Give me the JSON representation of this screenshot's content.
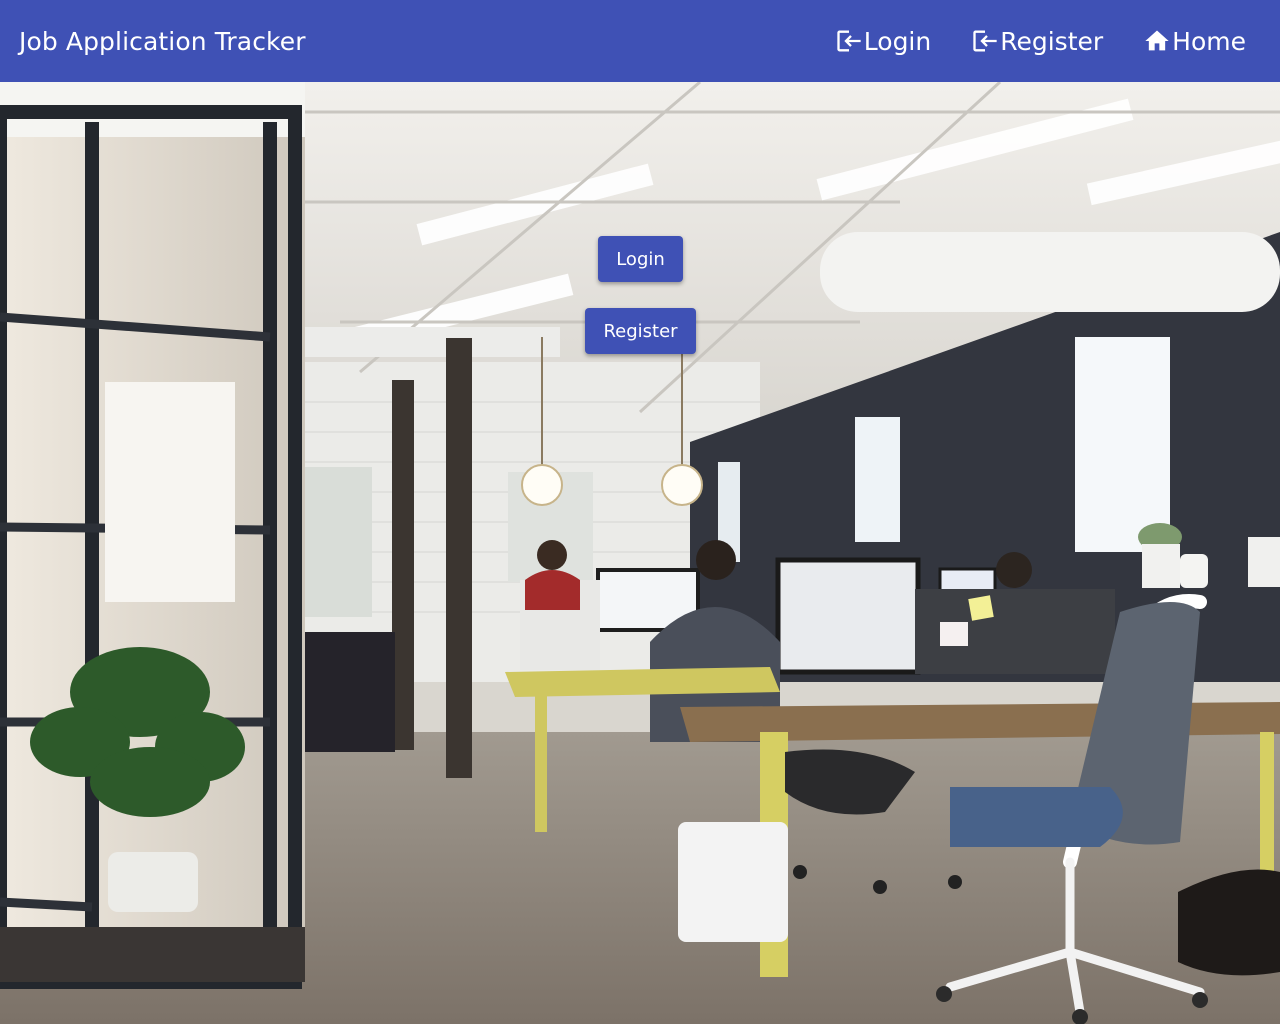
{
  "header": {
    "title": "Job Application Tracker",
    "nav": {
      "login": {
        "label": "Login",
        "icon": "login-icon"
      },
      "register": {
        "label": "Register",
        "icon": "login-icon"
      },
      "home": {
        "label": "Home",
        "icon": "home-icon"
      }
    }
  },
  "hero": {
    "image": "office-interior-photo",
    "buttons": {
      "login": "Login",
      "register": "Register"
    }
  },
  "colors": {
    "primary": "#3f51b5",
    "on_primary": "#ffffff"
  }
}
